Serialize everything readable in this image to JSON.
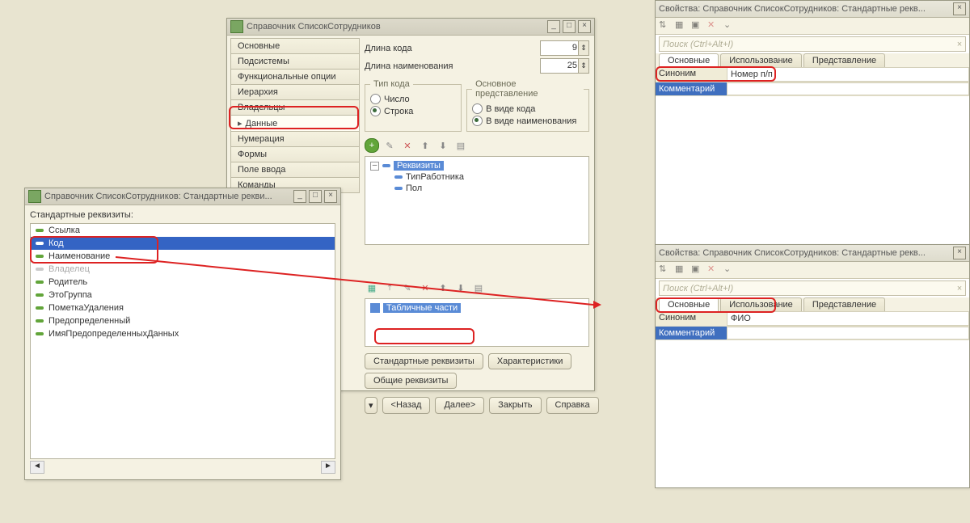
{
  "main": {
    "title": "Справочник СписокСотрудников",
    "tabs": [
      "Основные",
      "Подсистемы",
      "Функциональные опции",
      "Иерархия",
      "Владельцы",
      "Данные",
      "Нумерация",
      "Формы",
      "Поле ввода",
      "Команды"
    ],
    "active_tab": "Данные",
    "code_len_label": "Длина кода",
    "code_len_value": "9",
    "name_len_label": "Длина наименования",
    "name_len_value": "25",
    "code_type_legend": "Тип кода",
    "code_type_options": {
      "number": "Число",
      "string": "Строка"
    },
    "main_repr_legend": "Основное представление",
    "main_repr_options": {
      "code": "В виде кода",
      "name": "В виде наименования"
    },
    "tree": {
      "root": "Реквизиты",
      "children": [
        "ТипРаботника",
        "Пол"
      ]
    },
    "tab_parts": "Табличные части",
    "btn_std_req": "Стандартные реквизиты",
    "btn_char": "Характеристики",
    "btn_common": "Общие реквизиты",
    "nav": {
      "prev": "<Назад",
      "next": "Далее>",
      "close": "Закрыть",
      "help": "Справка"
    }
  },
  "left": {
    "title": "Справочник СписокСотрудников: Стандартные рекви...",
    "list_label": "Стандартные реквизиты:",
    "items": [
      "Ссылка",
      "Код",
      "Наименование",
      "Владелец",
      "Родитель",
      "ЭтоГруппа",
      "ПометкаУдаления",
      "Предопределенный",
      "ИмяПредопределенныхДанных"
    ],
    "selected": "Код",
    "disabled": "Владелец"
  },
  "prop": {
    "title": "Свойства: Справочник СписокСотрудников: Стандартные рекв...",
    "search_placeholder": "Поиск (Ctrl+Alt+I)",
    "tabs": [
      "Основные",
      "Использование",
      "Представление"
    ],
    "row_syn": "Синоним",
    "row_comm": "Комментарий",
    "val1": "Номер п/п",
    "val2": "ФИО"
  }
}
